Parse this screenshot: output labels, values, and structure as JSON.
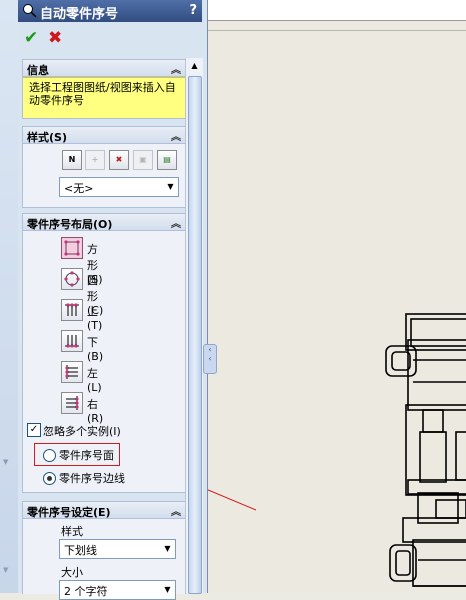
{
  "title": "自动零件序号",
  "help": "?",
  "info": {
    "header": "信息",
    "text": "选择工程图图纸/视图来插入自动零件序号"
  },
  "style_group": {
    "header": "样式(S)",
    "selected": "<无>"
  },
  "layout_group": {
    "header": "零件序号布局(O)",
    "items": [
      "方形(S)",
      "圆形(C)",
      "上(T)",
      "下(B)",
      "左(L)",
      "右(R)"
    ],
    "ignore_instances": "忽略多个实例(I)",
    "radio_face": "零件序号面",
    "radio_edge": "零件序号边线"
  },
  "settings_group": {
    "header": "零件序号设定(E)",
    "style_label": "样式",
    "style_value": "下划线",
    "size_label": "大小",
    "size_value": "2 个字符"
  },
  "colors": {
    "annotation_red": "#d21d1d",
    "ok_green": "#1c9a17",
    "cancel_red": "#d0161b"
  }
}
